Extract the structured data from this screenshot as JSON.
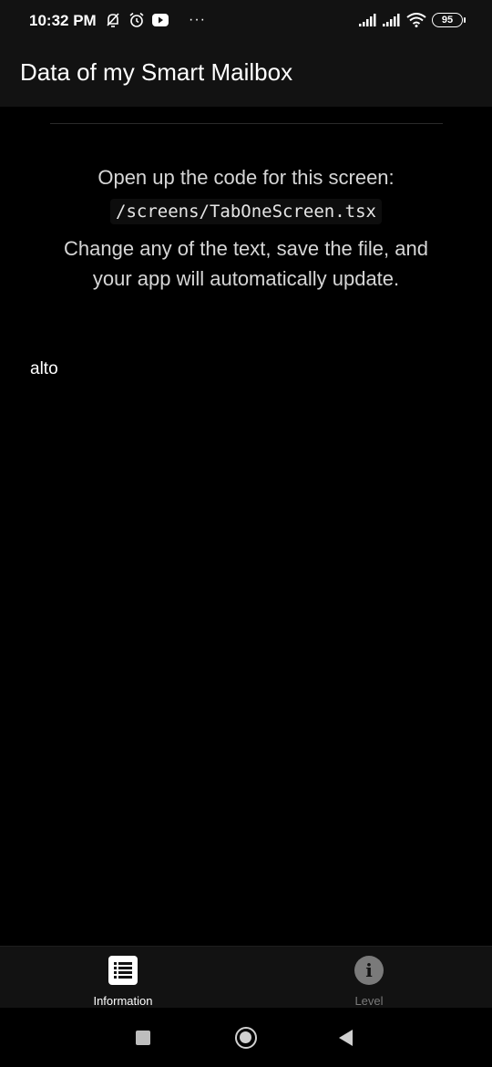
{
  "status_bar": {
    "time": "10:32 PM",
    "battery": "95",
    "icons": [
      "notifications-off-icon",
      "alarm-icon",
      "youtube-icon",
      "more-dots-icon",
      "signal-icon",
      "signal-icon",
      "wifi-icon",
      "battery-icon"
    ]
  },
  "header": {
    "title": "Data of my Smart Mailbox"
  },
  "main": {
    "intro": "Open up the code for this screen:",
    "path": "/screens/TabOneScreen.tsx",
    "help": "Change any of the text, save the file, and your app will automatically update.",
    "value": "alto"
  },
  "tabs": [
    {
      "label": "Information",
      "icon": "list-icon",
      "active": true
    },
    {
      "label": "Level",
      "icon": "info-icon",
      "active": false
    }
  ],
  "nav": {
    "buttons": [
      "recents-icon",
      "home-icon",
      "back-icon"
    ]
  },
  "colors": {
    "background": "#000000",
    "bar": "#121212",
    "active_tab": "#ffffff",
    "inactive_tab": "#7a7a7a"
  }
}
